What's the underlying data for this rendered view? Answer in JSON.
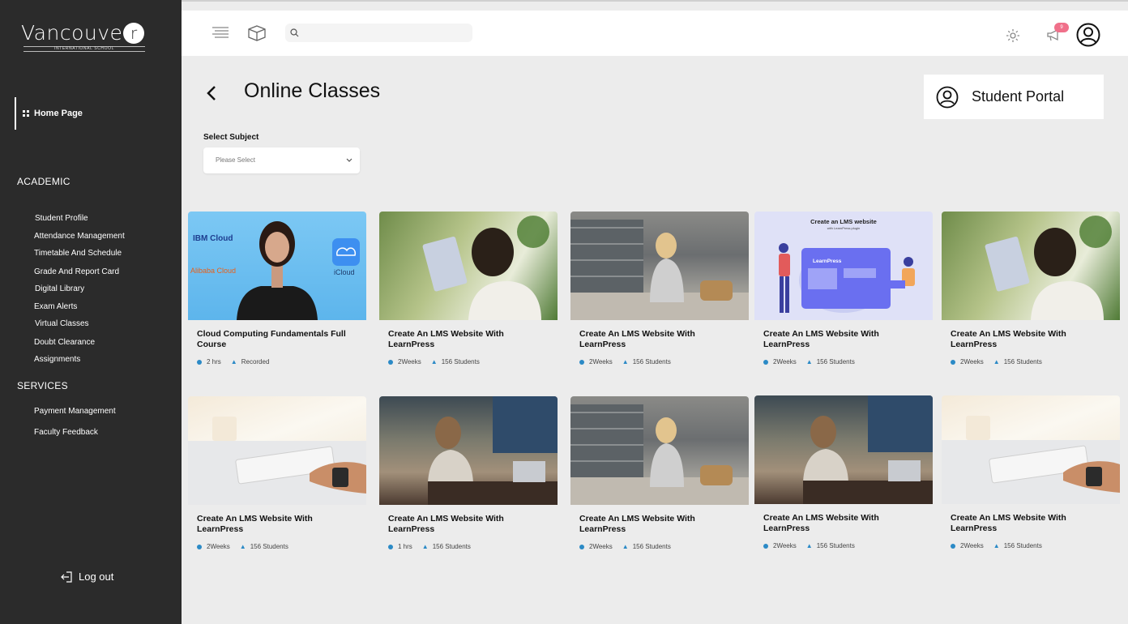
{
  "sidebar": {
    "logo": {
      "word": "Vancouve",
      "r": "r",
      "sub": "INTERNATIONAL SCHOOL"
    },
    "home": "Home Page",
    "academic_title": "ACADEMIC",
    "academic_items": [
      "Student Profile",
      "Attendance Management",
      "Timetable And Schedule",
      "Grade And Report Card",
      "Digital Library",
      "Exam Alerts",
      "Virtual Classes",
      "Doubt Clearance",
      "Assignments"
    ],
    "services_title": "SERVICES",
    "services_items": [
      "Payment Management",
      "Faculty Feedback"
    ],
    "logout": "Log out"
  },
  "topbar": {
    "search_placeholder": "",
    "notification_count": "9"
  },
  "header": {
    "title": "Online Classes",
    "portal": "Student Portal"
  },
  "filter": {
    "label": "Select Subject",
    "placeholder": "Please Select"
  },
  "courses": [
    {
      "title": "Cloud Computing Fundamentals Full Course",
      "duration": "2 hrs",
      "extra": "Recorded",
      "thumb": "cloud",
      "thumb_text": {
        "ibm": "IBM Cloud",
        "alibaba": "Alibaba Cloud",
        "icloud": "iCloud"
      }
    },
    {
      "title": "Create An LMS Website With LearnPress",
      "duration": "2Weeks",
      "extra": "156 Students",
      "thumb": "green"
    },
    {
      "title": "Create An LMS Website With LearnPress",
      "duration": "2Weeks",
      "extra": "156 Students",
      "thumb": "building"
    },
    {
      "title": "Create An LMS Website With LearnPress",
      "duration": "2Weeks",
      "extra": "156 Students",
      "thumb": "lms",
      "thumb_text": {
        "heading": "Create an LMS website",
        "sub": "with LearnPress plugin",
        "brand": "LearnPress"
      }
    },
    {
      "title": "Create An LMS Website With LearnPress",
      "duration": "2Weeks",
      "extra": "156 Students",
      "thumb": "green"
    },
    {
      "title": "Create An LMS Website With LearnPress",
      "duration": "2Weeks",
      "extra": "156 Students",
      "thumb": "desk"
    },
    {
      "title": "Create An LMS Website With LearnPress",
      "duration": "1 hrs",
      "extra": "156 Students",
      "thumb": "hall"
    },
    {
      "title": "Create An LMS Website With LearnPress",
      "duration": "2Weeks",
      "extra": "156 Students",
      "thumb": "building"
    },
    {
      "title": "Create An LMS Website With LearnPress",
      "duration": "2Weeks",
      "extra": "156 Students",
      "thumb": "hall"
    },
    {
      "title": "Create An LMS Website With LearnPress",
      "duration": "2Weeks",
      "extra": "156 Students",
      "thumb": "desk"
    }
  ],
  "colors": {
    "sidebar": "#2b2b2b",
    "accent": "#2b8ac6",
    "badge": "#f0708a",
    "background": "#ececec"
  }
}
